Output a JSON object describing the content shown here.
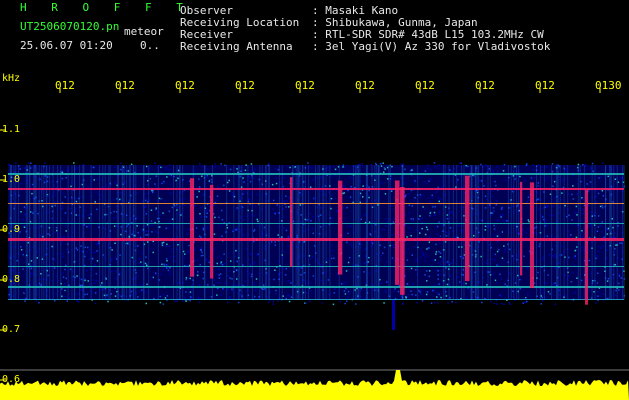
{
  "header": {
    "title": "H R O F F T",
    "filename": "UT2506070120.pn",
    "event_type": "meteor",
    "datetime": "25.06.07 01:20",
    "count": "0..",
    "info_labels": [
      "Observer",
      "Receiving Location",
      "Receiver",
      "Receiving Antenna"
    ],
    "info_values": [
      ": Masaki Kano",
      ": Shibukawa, Gunma, Japan",
      ": RTL-SDR SDR# 43dB L15 103.2MHz CW",
      ": 3el Yagi(V) Az 330 for Vladivostok"
    ]
  },
  "axis": {
    "unit": "kHz",
    "y_ticks": [
      "1.1",
      "1.0",
      "0.9",
      "0.8",
      "0.7",
      "0.6"
    ],
    "x_ticks": [
      "012",
      "012",
      "012",
      "012",
      "012",
      "012",
      "012",
      "012",
      "012",
      "0130"
    ]
  },
  "colors": {
    "header_text": "#33ff33",
    "info_text": "#e8e8e8",
    "axis_text": "#ffff00",
    "signal_low": "#0000aa",
    "signal_mid": "#22bbbb",
    "signal_high": "#ff2266",
    "power_trace": "#ffff00"
  }
}
